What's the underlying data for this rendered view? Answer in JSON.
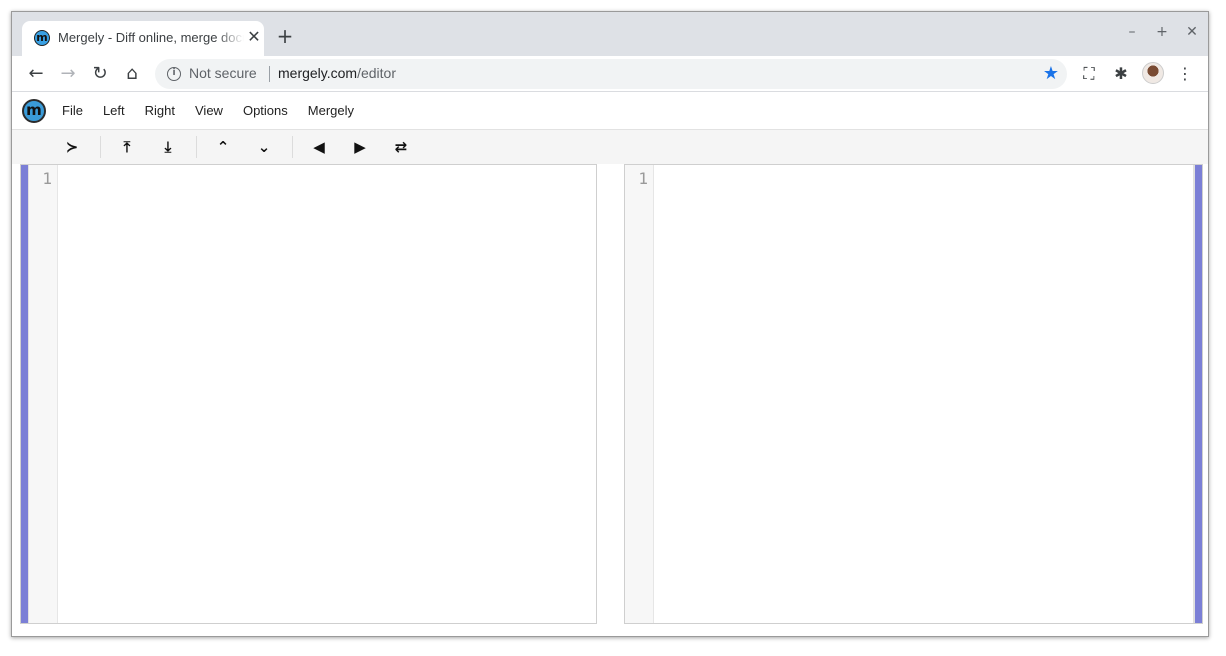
{
  "browser": {
    "tab_title": "Mergely - Diff online, merge documents",
    "tab_favicon": "m",
    "close_glyph": "✕",
    "new_tab_glyph": "+",
    "window_controls": [
      "–",
      "+",
      "✕"
    ],
    "nav": {
      "back": "←",
      "forward": "→",
      "reload": "↻",
      "home": "⌂"
    },
    "security_label": "Not secure",
    "url_host": "mergely.com",
    "url_path": "/editor",
    "star_glyph": "★",
    "accent_color": "#1a73e8"
  },
  "app": {
    "logo_letter": "m",
    "menu": [
      "File",
      "Left",
      "Right",
      "View",
      "Options",
      "Mergely"
    ],
    "toolbar_icons": [
      {
        "name": "options-icon",
        "glyph": "≻"
      },
      {
        "name": "upload-icon",
        "glyph": "⤒"
      },
      {
        "name": "download-icon",
        "glyph": "⤓"
      },
      {
        "name": "prev-diff-icon",
        "glyph": "⌃"
      },
      {
        "name": "next-diff-icon",
        "glyph": "⌄"
      },
      {
        "name": "merge-left-icon",
        "glyph": "◀"
      },
      {
        "name": "merge-right-icon",
        "glyph": "▶"
      },
      {
        "name": "swap-icon",
        "glyph": "⇄"
      }
    ],
    "left_editor": {
      "line_numbers": [
        "1"
      ]
    },
    "right_editor": {
      "line_numbers": [
        "1"
      ]
    },
    "margin_color": "#7b7fd6"
  }
}
